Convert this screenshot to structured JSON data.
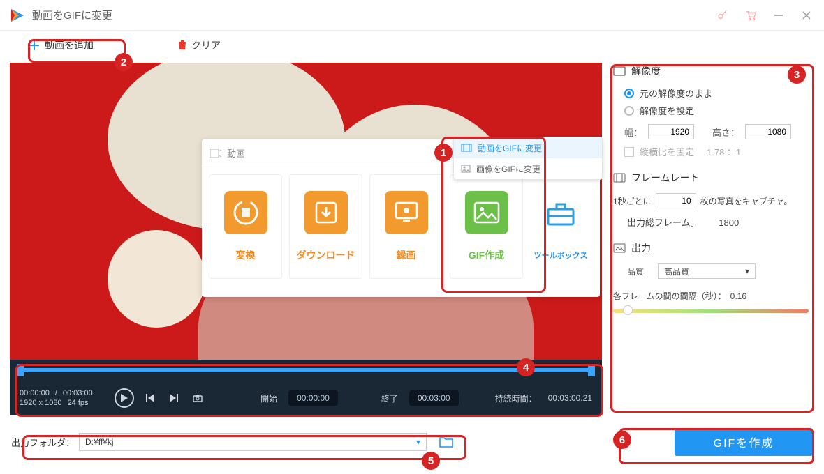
{
  "app": {
    "title": "動画をGIFに変更"
  },
  "toolbar": {
    "add_video_label": "動画を追加",
    "clear_label": "クリア"
  },
  "popup": {
    "header_label": "動画",
    "categories": [
      {
        "label": "変換",
        "icon": "convert-icon"
      },
      {
        "label": "ダウンロード",
        "icon": "download-icon"
      },
      {
        "label": "録画",
        "icon": "record-icon"
      },
      {
        "label": "GIF作成",
        "icon": "gif-icon"
      },
      {
        "label": "ツールボックス",
        "icon": "toolbox-icon"
      }
    ]
  },
  "gif_submenu": {
    "video_to_gif": "動画をGIFに変更",
    "image_to_gif": "画像をGIFに変更"
  },
  "timeline": {
    "position": "00:00:00",
    "duration": "00:03:00",
    "resolution": "1920 x 1080",
    "fps": "24 fps",
    "start_label": "開始",
    "start_value": "00:00:00",
    "end_label": "終了",
    "end_value": "00:03:00",
    "hold_label": "持続時間：",
    "hold_value": "00:03:00.21"
  },
  "panel": {
    "resolution": {
      "title": "解像度",
      "keep_original": "元の解像度のまま",
      "set_resolution": "解像度を設定",
      "width_label": "幅：",
      "width_value": "1920",
      "height_label": "高さ：",
      "height_value": "1080",
      "lock_aspect": "縦横比を固定",
      "aspect_ratio": "1.78 ：1"
    },
    "framerate": {
      "title": "フレームレート",
      "prefix": "1秒ごとに",
      "value": "10",
      "suffix": "枚の写真をキャプチャ。",
      "total_label": "出力総フレーム。",
      "total_value": "1800"
    },
    "output": {
      "title": "出力",
      "quality_label": "品質",
      "quality_value": "高品質",
      "interval_label": "各フレームの間の間隔（秒）：",
      "interval_value": "0.16"
    }
  },
  "bottom": {
    "folder_label": "出力フォルダ：",
    "folder_value": "D:¥ff¥kj",
    "create_label": "GIFを作成"
  },
  "annotations": {
    "a1": "1",
    "a2": "2",
    "a3": "3",
    "a4": "4",
    "a5": "5",
    "a6": "6"
  }
}
